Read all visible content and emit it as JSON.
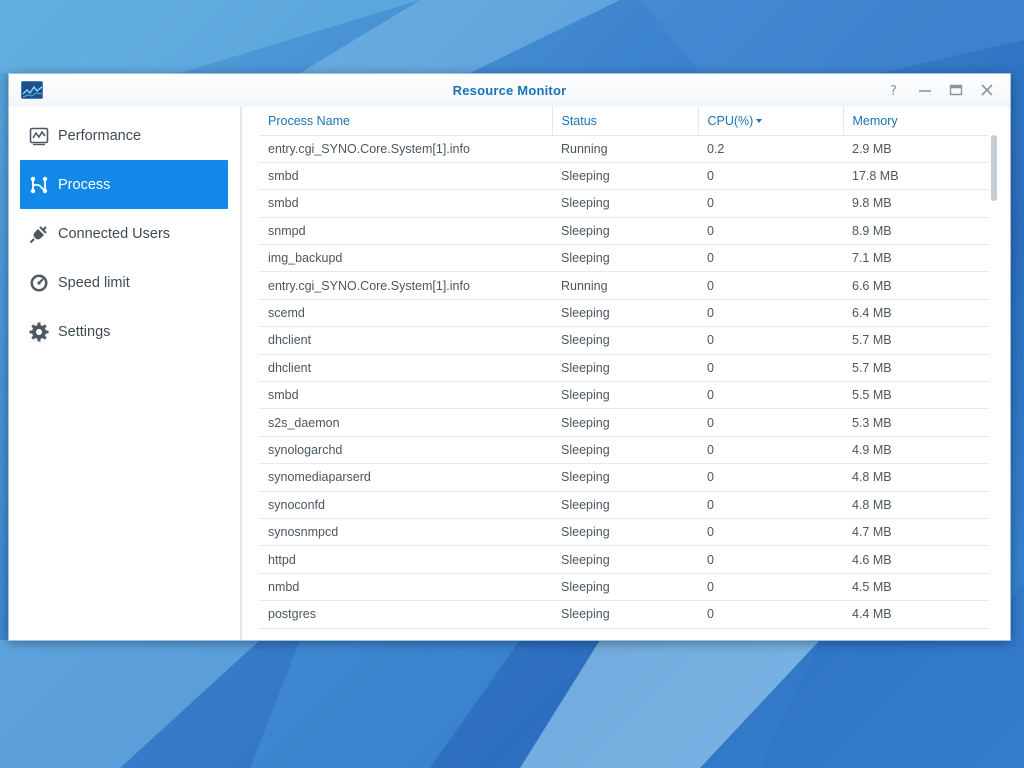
{
  "window": {
    "title": "Resource Monitor",
    "controls": [
      "help-icon",
      "minimize-icon",
      "maximize-icon",
      "close-icon"
    ]
  },
  "sidebar": {
    "items": [
      {
        "label": "Performance",
        "icon": "performance-icon",
        "active": false
      },
      {
        "label": "Process",
        "icon": "process-icon",
        "active": true
      },
      {
        "label": "Connected Users",
        "icon": "plug-icon",
        "active": false
      },
      {
        "label": "Speed limit",
        "icon": "speedometer-icon",
        "active": false
      },
      {
        "label": "Settings",
        "icon": "gear-icon",
        "active": false
      }
    ]
  },
  "table": {
    "columns": [
      "Process Name",
      "Status",
      "CPU(%)",
      "Memory"
    ],
    "sorted_column": "CPU(%)",
    "rows": [
      [
        "entry.cgi_SYNO.Core.System[1].info",
        "Running",
        "0.2",
        "2.9 MB"
      ],
      [
        "smbd",
        "Sleeping",
        "0",
        "17.8 MB"
      ],
      [
        "smbd",
        "Sleeping",
        "0",
        "9.8 MB"
      ],
      [
        "snmpd",
        "Sleeping",
        "0",
        "8.9 MB"
      ],
      [
        "img_backupd",
        "Sleeping",
        "0",
        "7.1 MB"
      ],
      [
        "entry.cgi_SYNO.Core.System[1].info",
        "Running",
        "0",
        "6.6 MB"
      ],
      [
        "scemd",
        "Sleeping",
        "0",
        "6.4 MB"
      ],
      [
        "dhclient",
        "Sleeping",
        "0",
        "5.7 MB"
      ],
      [
        "dhclient",
        "Sleeping",
        "0",
        "5.7 MB"
      ],
      [
        "smbd",
        "Sleeping",
        "0",
        "5.5 MB"
      ],
      [
        "s2s_daemon",
        "Sleeping",
        "0",
        "5.3 MB"
      ],
      [
        "synologarchd",
        "Sleeping",
        "0",
        "4.9 MB"
      ],
      [
        "synomediaparserd",
        "Sleeping",
        "0",
        "4.8 MB"
      ],
      [
        "synoconfd",
        "Sleeping",
        "0",
        "4.8 MB"
      ],
      [
        "synosnmpcd",
        "Sleeping",
        "0",
        "4.7 MB"
      ],
      [
        "httpd",
        "Sleeping",
        "0",
        "4.6 MB"
      ],
      [
        "nmbd",
        "Sleeping",
        "0",
        "4.5 MB"
      ],
      [
        "postgres",
        "Sleeping",
        "0",
        "4.4 MB"
      ]
    ]
  },
  "colors": {
    "accent": "#1288e8",
    "header_text": "#1a73b8",
    "body_text": "#4b5661"
  }
}
